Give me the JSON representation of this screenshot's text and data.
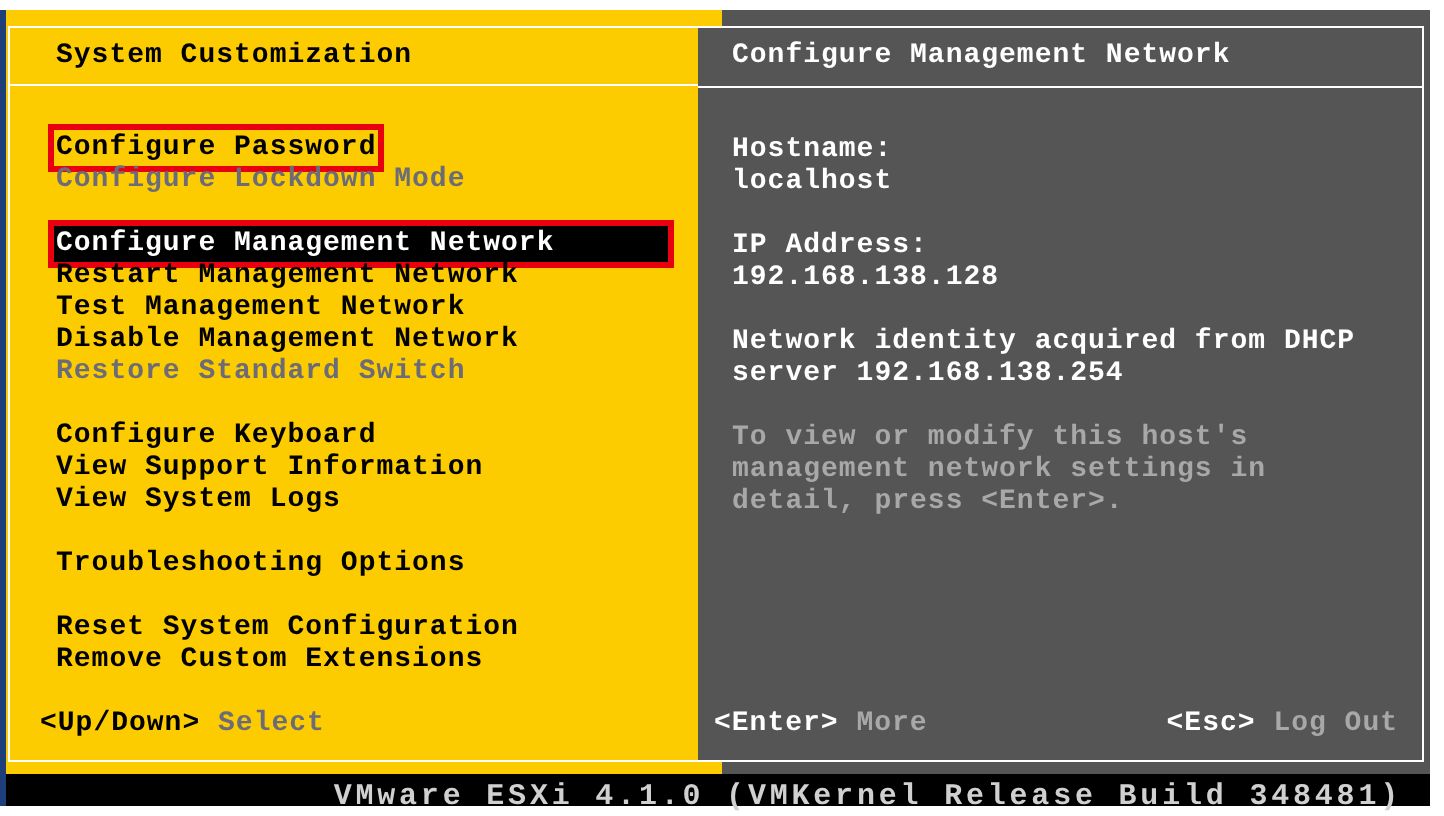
{
  "left_panel": {
    "title": "System Customization",
    "menu_groups": [
      {
        "items": [
          {
            "label": "Configure Password",
            "disabled": false,
            "selected": false,
            "highlighted": true
          },
          {
            "label": "Configure Lockdown Mode",
            "disabled": true,
            "selected": false,
            "highlighted": false
          }
        ]
      },
      {
        "items": [
          {
            "label": "Configure Management Network",
            "disabled": false,
            "selected": true,
            "highlighted": true
          },
          {
            "label": "Restart Management Network",
            "disabled": false,
            "selected": false,
            "highlighted": false
          },
          {
            "label": "Test Management Network",
            "disabled": false,
            "selected": false,
            "highlighted": false
          },
          {
            "label": "Disable Management Network",
            "disabled": false,
            "selected": false,
            "highlighted": false
          },
          {
            "label": "Restore Standard Switch",
            "disabled": true,
            "selected": false,
            "highlighted": false
          }
        ]
      },
      {
        "items": [
          {
            "label": "Configure Keyboard",
            "disabled": false,
            "selected": false,
            "highlighted": false
          },
          {
            "label": "View Support Information",
            "disabled": false,
            "selected": false,
            "highlighted": false
          },
          {
            "label": "View System Logs",
            "disabled": false,
            "selected": false,
            "highlighted": false
          }
        ]
      },
      {
        "items": [
          {
            "label": "Troubleshooting Options",
            "disabled": false,
            "selected": false,
            "highlighted": false
          }
        ]
      },
      {
        "items": [
          {
            "label": "Reset System Configuration",
            "disabled": false,
            "selected": false,
            "highlighted": false
          },
          {
            "label": "Remove Custom Extensions",
            "disabled": false,
            "selected": false,
            "highlighted": false
          }
        ]
      }
    ],
    "hints": [
      {
        "key": "<Up/Down>",
        "action": "Select"
      }
    ]
  },
  "right_panel": {
    "title": "Configure Management Network",
    "fields": [
      {
        "label": "Hostname:",
        "value": "localhost"
      },
      {
        "label": "IP Address:",
        "value": "192.168.138.128"
      }
    ],
    "note": "Network identity acquired from DHCP server 192.168.138.254",
    "description": "To view or modify this host's management network settings in detail, press <Enter>.",
    "hints": [
      {
        "key": "<Enter>",
        "action": "More"
      },
      {
        "key": "<Esc>",
        "action": "Log Out"
      }
    ]
  },
  "status_bar": "VMware ESXi 4.1.0 (VMKernel Release Build 348481)"
}
